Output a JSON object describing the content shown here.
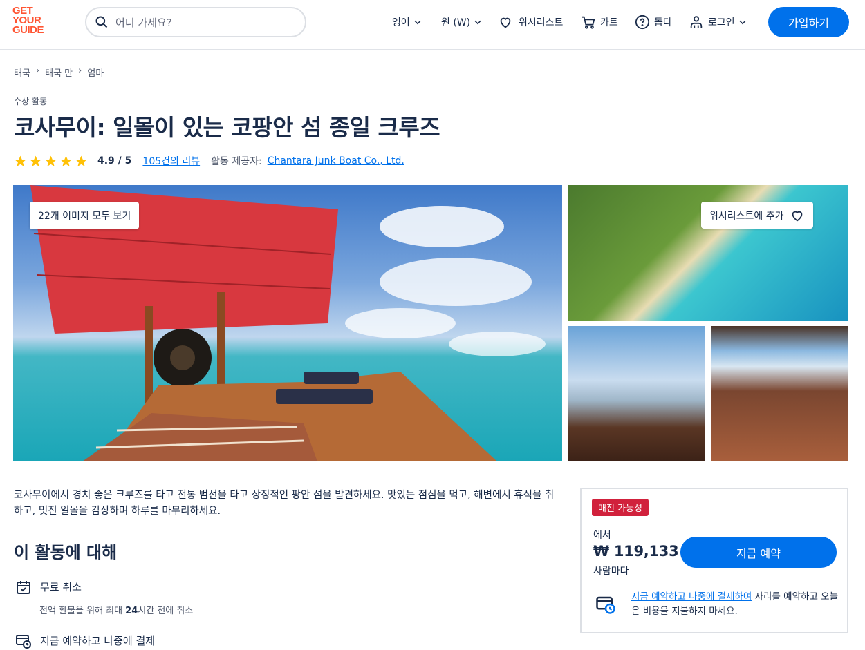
{
  "header": {
    "logo_lines": [
      "GET",
      "YOUR",
      "GUIDE"
    ],
    "search_placeholder": "어디 가세요?",
    "nav": {
      "language": "영어",
      "currency": "원 (W)",
      "wishlist": "위시리스트",
      "cart": "카트",
      "help": "돕다",
      "login": "로그인"
    },
    "signup_label": "가입하기"
  },
  "breadcrumb": [
    "태국",
    "태국 만",
    "엄마"
  ],
  "breadcrumb_separator": "›",
  "category": "수상 활동",
  "title": "코사무이: 일몰이 있는 코팡안 섬 종일 크루즈",
  "rating": {
    "stars": 5,
    "score": "4.9 / 5",
    "reviews_link": "105건의 리뷰",
    "provider_label": "활동 제공자:",
    "provider_name": "Chantara Junk Boat Co., Ltd."
  },
  "gallery": {
    "see_all_label": "22개 이미지 모두 보기",
    "wishlist_add_label": "위시리스트에 추가"
  },
  "description": "코사무이에서 경치 좋은 크루즈를 타고 전통 범선을 타고 상징적인 팡안 섬을 발견하세요. 맛있는 점심을 먹고, 해변에서 휴식을 취하고, 멋진 일몰을 감상하며 하루를 마무리하세요.",
  "about": {
    "title": "이 활동에 대해",
    "free_cancel_title": "무료 취소",
    "free_cancel_sub_pre": "전액 환불을 위해 최대 ",
    "free_cancel_sub_bold": "24",
    "free_cancel_sub_post": "시간 전에 취소",
    "reserve_title": "지금 예약하고 나중에 결제"
  },
  "booking": {
    "badge": "매진 가능성",
    "from_label": "에서",
    "price": "₩ 119,133",
    "per_label": "사람마다",
    "book_button": "지금 예약",
    "note_link": "지금 예약하고 나중에 결제하여",
    "note_rest": " 자리를 예약하고 오늘은 비용을 지불하지 마세요."
  },
  "colors": {
    "brand_orange": "#ff5533",
    "primary_blue": "#0071eb",
    "badge_red": "#d1213c",
    "star_yellow": "#ffc107",
    "text_dark": "#1a2b49"
  },
  "icons": [
    "search-icon",
    "chevron-down-icon",
    "heart-icon",
    "cart-icon",
    "help-icon",
    "user-icon",
    "star-icon",
    "calendar-check-icon",
    "card-clock-icon"
  ]
}
